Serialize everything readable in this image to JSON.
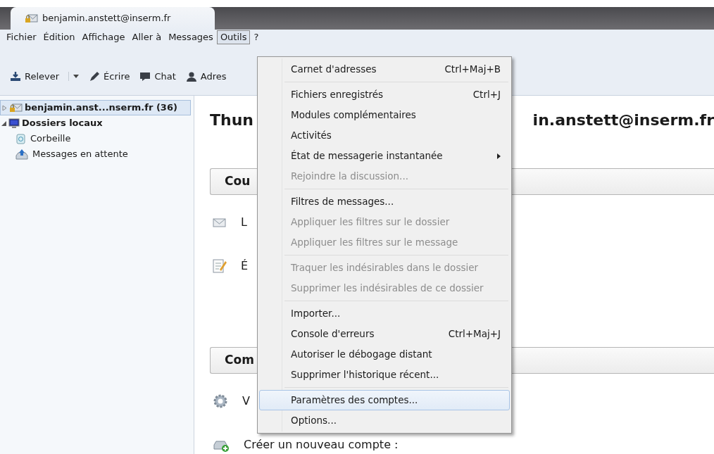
{
  "window": {
    "tab_title": "benjamin.anstett@inserm.fr"
  },
  "menu_bar": [
    {
      "label": "Fichier",
      "selected": false
    },
    {
      "label": "Édition",
      "selected": false
    },
    {
      "label": "Affichage",
      "selected": false
    },
    {
      "label": "Aller à",
      "selected": false
    },
    {
      "label": "Messages",
      "selected": false
    },
    {
      "label": "Outils",
      "selected": true
    },
    {
      "label": "?",
      "selected": false
    }
  ],
  "toolbar": [
    {
      "kind": "get",
      "label": "Relever",
      "dropdown": true
    },
    {
      "kind": "write",
      "label": "Écrire",
      "dropdown": false
    },
    {
      "kind": "chat",
      "label": "Chat",
      "dropdown": false
    },
    {
      "kind": "contacts",
      "label": "Adres",
      "dropdown": false
    }
  ],
  "folders": [
    {
      "kind": "account",
      "label": "benjamin.anst...nserm.fr (36)",
      "selected": true,
      "expanded": false
    },
    {
      "kind": "local",
      "label": "Dossiers locaux",
      "selected": false,
      "expanded": true,
      "children": [
        {
          "kind": "trash",
          "label": "Corbeille",
          "selected": false
        },
        {
          "kind": "outbox",
          "label": "Messages en attente",
          "selected": false
        }
      ]
    }
  ],
  "main": {
    "heading_left": "Thun",
    "heading_right": "in.anstett@inserm.fr",
    "sections": [
      {
        "title": "Cou",
        "actions": [
          {
            "kind": "mail",
            "label": "L"
          },
          {
            "kind": "compose",
            "label": "É"
          }
        ]
      },
      {
        "title": "Com",
        "actions": [
          {
            "kind": "settings",
            "label": "V"
          },
          {
            "kind": "new-account",
            "label": "Créer un nouveau compte :"
          }
        ]
      }
    ]
  },
  "tools_menu": [
    {
      "kind": "item",
      "label": "Carnet d'adresses",
      "shortcut": "Ctrl+Maj+B",
      "disabled": false,
      "selected": false,
      "submenu": false
    },
    {
      "kind": "separator"
    },
    {
      "kind": "item",
      "label": "Fichiers enregistrés",
      "shortcut": "Ctrl+J",
      "disabled": false,
      "selected": false,
      "submenu": false
    },
    {
      "kind": "item",
      "label": "Modules complémentaires",
      "disabled": false,
      "selected": false,
      "submenu": false
    },
    {
      "kind": "item",
      "label": "Activités",
      "disabled": false,
      "selected": false,
      "submenu": false
    },
    {
      "kind": "item",
      "label": "État de messagerie instantanée",
      "disabled": false,
      "selected": false,
      "submenu": true
    },
    {
      "kind": "item",
      "label": "Rejoindre la discussion...",
      "disabled": true,
      "selected": false,
      "submenu": false
    },
    {
      "kind": "separator"
    },
    {
      "kind": "item",
      "label": "Filtres de messages...",
      "disabled": false,
      "selected": false,
      "submenu": false
    },
    {
      "kind": "item",
      "label": "Appliquer les filtres sur le dossier",
      "disabled": true,
      "selected": false,
      "submenu": false
    },
    {
      "kind": "item",
      "label": "Appliquer les filtres sur le message",
      "disabled": true,
      "selected": false,
      "submenu": false
    },
    {
      "kind": "separator"
    },
    {
      "kind": "item",
      "label": "Traquer les indésirables dans le dossier",
      "disabled": true,
      "selected": false,
      "submenu": false
    },
    {
      "kind": "item",
      "label": "Supprimer les indésirables de ce dossier",
      "disabled": true,
      "selected": false,
      "submenu": false
    },
    {
      "kind": "separator"
    },
    {
      "kind": "item",
      "label": "Importer...",
      "disabled": false,
      "selected": false,
      "submenu": false
    },
    {
      "kind": "item",
      "label": "Console d'erreurs",
      "shortcut": "Ctrl+Maj+J",
      "disabled": false,
      "selected": false,
      "submenu": false
    },
    {
      "kind": "item",
      "label": "Autoriser le débogage distant",
      "disabled": false,
      "selected": false,
      "submenu": false
    },
    {
      "kind": "item",
      "label": "Supprimer l'historique récent...",
      "disabled": false,
      "selected": false,
      "submenu": false
    },
    {
      "kind": "separator"
    },
    {
      "kind": "item",
      "label": "Paramètres des comptes...",
      "disabled": false,
      "selected": true,
      "submenu": false
    },
    {
      "kind": "item",
      "label": "Options...",
      "disabled": false,
      "selected": false,
      "submenu": false
    }
  ]
}
